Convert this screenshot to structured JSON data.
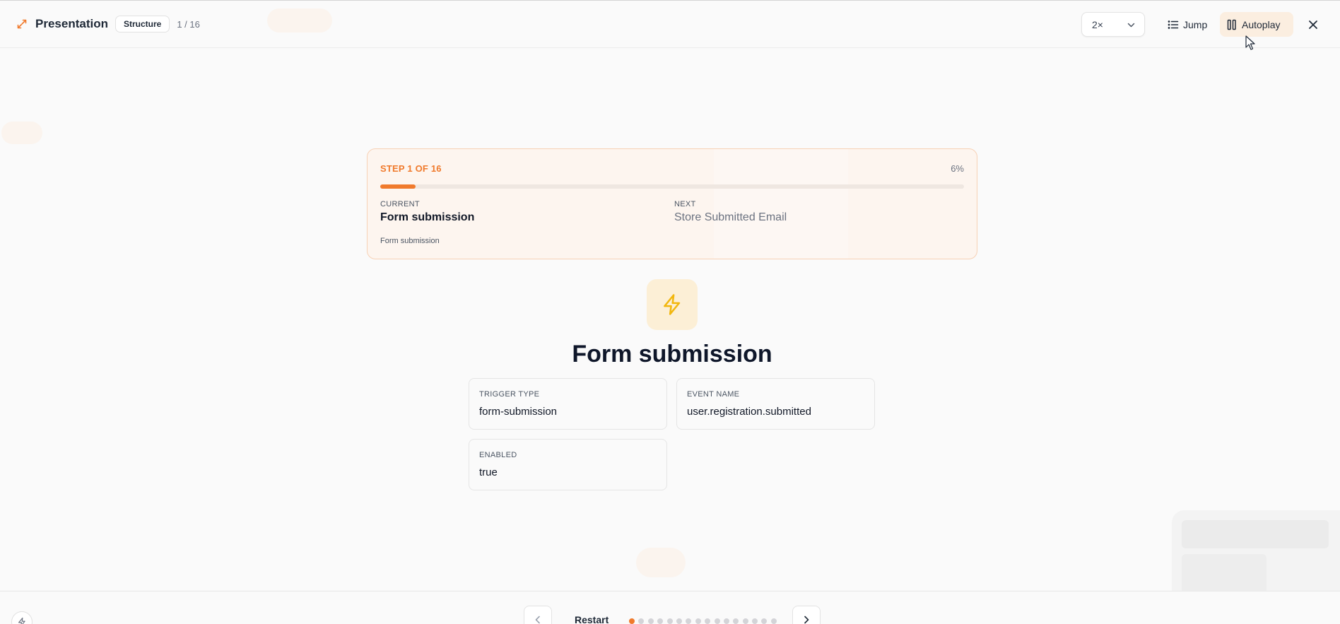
{
  "header": {
    "title": "Presentation",
    "badge": "Structure",
    "counter": "1 / 16",
    "speed": "2×",
    "jump_label": "Jump",
    "autoplay_label": "Autoplay"
  },
  "step_card": {
    "step_label": "STEP 1 OF 16",
    "percent_label": "6%",
    "progress": 0.06,
    "current_label": "CURRENT",
    "current_value": "Form submission",
    "next_label": "NEXT",
    "next_value": "Store Submitted Email",
    "description": "Form submission"
  },
  "hero": {
    "icon": "lightning-bolt-icon",
    "title": "Form submission"
  },
  "fields": [
    {
      "label": "TRIGGER TYPE",
      "value": "form-submission"
    },
    {
      "label": "EVENT NAME",
      "value": "user.registration.submitted"
    },
    {
      "label": "ENABLED",
      "value": "true"
    }
  ],
  "footer": {
    "restart_label": "Restart",
    "total_steps": 16,
    "current_step": 1
  },
  "colors": {
    "accent": "#f07a2c",
    "icon_yellow": "#f2b70f",
    "icon_bg": "#fcefd6"
  }
}
